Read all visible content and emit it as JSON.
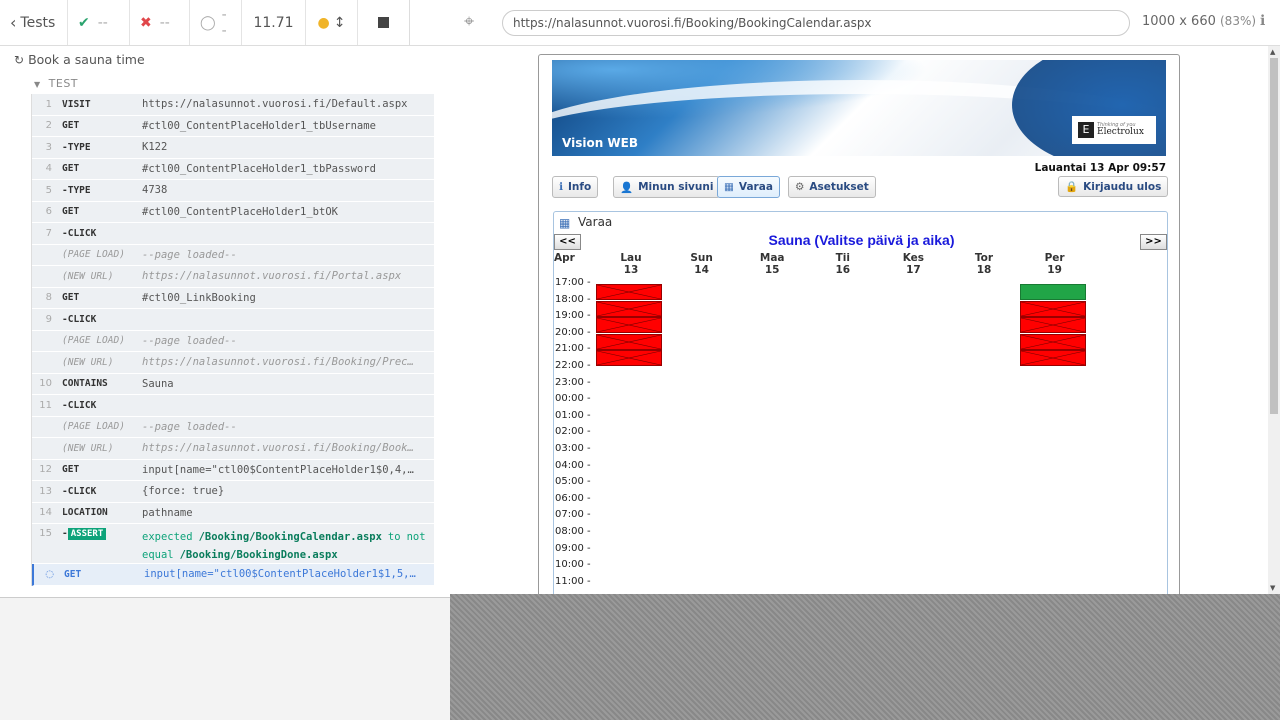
{
  "runner": {
    "tests_label": "Tests",
    "passed": "--",
    "failed": "--",
    "pending": "--",
    "duration": "11.71",
    "suite_title": "Book a sauna time",
    "test_title": "TEST"
  },
  "commands": [
    {
      "num": "1",
      "name": "VISIT",
      "msg": "https://nalasunnot.vuorosi.fi/Default.aspx"
    },
    {
      "num": "2",
      "name": "GET",
      "msg": "#ctl00_ContentPlaceHolder1_tbUsername"
    },
    {
      "num": "3",
      "name": "-TYPE",
      "msg": "K122"
    },
    {
      "num": "4",
      "name": "GET",
      "msg": "#ctl00_ContentPlaceHolder1_tbPassword"
    },
    {
      "num": "5",
      "name": "-TYPE",
      "msg": "4738"
    },
    {
      "num": "6",
      "name": "GET",
      "msg": "#ctl00_ContentPlaceHolder1_btOK"
    },
    {
      "num": "7",
      "name": "-CLICK",
      "msg": ""
    },
    {
      "num": "",
      "name": "(PAGE LOAD)",
      "msg": "--page loaded--",
      "event": true
    },
    {
      "num": "",
      "name": "(NEW URL)",
      "msg": "https://nalasunnot.vuorosi.fi/Portal.aspx",
      "event": true
    },
    {
      "num": "8",
      "name": "GET",
      "msg": "#ctl00_LinkBooking"
    },
    {
      "num": "9",
      "name": "-CLICK",
      "msg": ""
    },
    {
      "num": "",
      "name": "(PAGE LOAD)",
      "msg": "--page loaded--",
      "event": true
    },
    {
      "num": "",
      "name": "(NEW URL)",
      "msg": "https://nalasunnot.vuorosi.fi/Booking/Prec…",
      "event": true
    },
    {
      "num": "10",
      "name": "CONTAINS",
      "msg": "Sauna"
    },
    {
      "num": "11",
      "name": "-CLICK",
      "msg": ""
    },
    {
      "num": "",
      "name": "(PAGE LOAD)",
      "msg": "--page loaded--",
      "event": true
    },
    {
      "num": "",
      "name": "(NEW URL)",
      "msg": "https://nalasunnot.vuorosi.fi/Booking/Book…",
      "event": true
    },
    {
      "num": "12",
      "name": "GET",
      "msg": "input[name=\"ctl00$ContentPlaceHolder1$0,4,…"
    },
    {
      "num": "13",
      "name": "-CLICK",
      "msg": "{force: true}"
    },
    {
      "num": "14",
      "name": "LOCATION",
      "msg": "pathname"
    }
  ],
  "assert": {
    "num": "15",
    "badge": "ASSERT",
    "expected": "expected",
    "actual": "/Booking/BookingCalendar.aspx",
    "to": "to",
    "not_equal": "not equal",
    "target": "/Booking/BookingDone.aspx"
  },
  "pending_cmd": {
    "name": "GET",
    "msg": "input[name=\"ctl00$ContentPlaceHolder1$1,5,…"
  },
  "browser": {
    "url": "https://nalasunnot.vuorosi.fi/Booking/BookingCalendar.aspx",
    "size": "1000 x 660",
    "zoom": "(83%)"
  },
  "app": {
    "brand": "Vision WEB",
    "logo_tagline": "Thinking of you",
    "logo_name": "Electrolux",
    "datetime": "Lauantai 13 Apr 09:57",
    "nav": [
      "Info",
      "Minun sivuni",
      "Varaa",
      "Asetukset"
    ],
    "logout": "Kirjaudu ulos",
    "panel_title": "Varaa",
    "prev": "<<",
    "next": ">>",
    "calendar_title": "Sauna (Valitse päivä ja aika)",
    "month": "Apr",
    "days": [
      {
        "name": "Lau",
        "date": "13"
      },
      {
        "name": "Sun",
        "date": "14"
      },
      {
        "name": "Maa",
        "date": "15"
      },
      {
        "name": "Tii",
        "date": "16"
      },
      {
        "name": "Kes",
        "date": "17"
      },
      {
        "name": "Tor",
        "date": "18"
      },
      {
        "name": "Per",
        "date": "19"
      }
    ],
    "hours": [
      "17:00 -",
      "18:00 -",
      "19:00 -",
      "20:00 -",
      "21:00 -",
      "22:00 -",
      "23:00 -",
      "00:00 -",
      "01:00 -",
      "02:00 -",
      "03:00 -",
      "04:00 -",
      "05:00 -",
      "06:00 -",
      "07:00 -",
      "08:00 -",
      "09:00 -",
      "10:00 -",
      "11:00 -"
    ],
    "slots": [
      {
        "day": 0,
        "hour": 1,
        "status": "booked"
      },
      {
        "day": 0,
        "hour": 2,
        "status": "booked"
      },
      {
        "day": 0,
        "hour": 3,
        "status": "booked"
      },
      {
        "day": 0,
        "hour": 4,
        "status": "booked"
      },
      {
        "day": 0,
        "hour": 5,
        "status": "booked"
      },
      {
        "day": 6,
        "hour": 1,
        "status": "free"
      },
      {
        "day": 6,
        "hour": 2,
        "status": "booked"
      },
      {
        "day": 6,
        "hour": 3,
        "status": "booked"
      },
      {
        "day": 6,
        "hour": 4,
        "status": "booked"
      },
      {
        "day": 6,
        "hour": 5,
        "status": "booked"
      }
    ],
    "colors": {
      "booked": "#ff0000",
      "free": "#21a547",
      "title": "#1a1adb"
    }
  }
}
